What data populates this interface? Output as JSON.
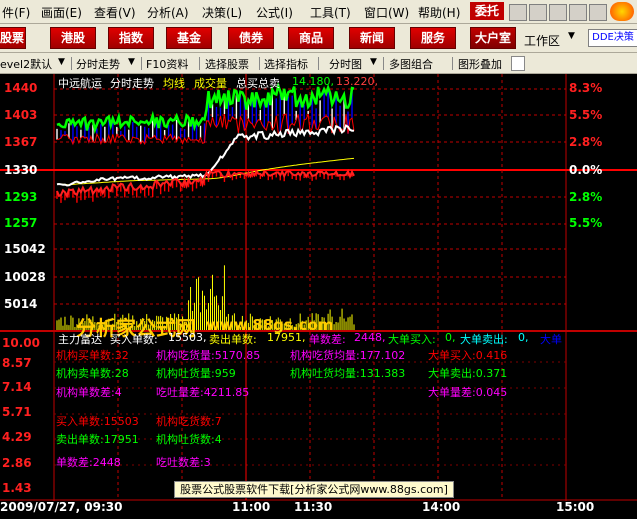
{
  "menu": {
    "items": [
      "件(F)",
      "画面(E)",
      "查看(V)",
      "分析(A)",
      "决策(L)",
      "公式(I)",
      "工具(T)",
      "窗口(W)",
      "帮助(H)"
    ],
    "weituo": "委托"
  },
  "toolbar": {
    "buttons": [
      "股票",
      "港股",
      "指数",
      "基金",
      "债券",
      "商品",
      "新闻",
      "服务",
      "大户室"
    ],
    "workspace": "工作区",
    "dde": "DDE决策"
  },
  "tabs": {
    "level": "evel2默认",
    "items": [
      "分时走势",
      "F10资料",
      "选择股票",
      "选择指标",
      "分时图",
      "多图组合",
      "图形叠加"
    ]
  },
  "header": {
    "stock": "中远航运",
    "mode": "分时走势",
    "avg": "均线",
    "vol": "成交量",
    "total": "总买总卖",
    "v1": "14.180,",
    "v2": "13.220,"
  },
  "axis": {
    "price": [
      "1440",
      "1403",
      "1367",
      "1330",
      "1293",
      "1257"
    ],
    "volume": [
      "15042",
      "10028",
      "5014"
    ],
    "pct": [
      "8.3%",
      "5.5%",
      "2.8%",
      "0.0%",
      "2.8%",
      "5.5%"
    ],
    "lower": [
      "10.00",
      "8.57",
      "7.14",
      "5.71",
      "4.29",
      "2.86",
      "1.43"
    ],
    "time": [
      "2009/07/27, 09:30",
      "11:00",
      "11:30",
      "14:00",
      "15:00"
    ]
  },
  "indicator": {
    "title": "主力富达",
    "buy_label": "买入单数:",
    "buy_val": "15503,",
    "sell_label": "卖出单数:",
    "sell_val": "17951,",
    "diff_label": "单数差:",
    "diff_val": "2448,",
    "big_buy_label": "大单买入:",
    "big_buy_val": "0,",
    "big_sell_label": "大单卖出:",
    "big_sell_val": "0,",
    "big_trunc": "大单"
  },
  "stats": {
    "r1": [
      "机构买单数:32",
      "机构吃货量:5170.85",
      "机构吃货均量:177.102",
      "大单买入:0.416"
    ],
    "r2": [
      "机构卖单数:28",
      "机构吐货量:959",
      "机构吐货均量:131.383",
      "大单卖出:0.371"
    ],
    "r3": [
      "机构单数差:4",
      "吃吐量差:4211.85",
      "大单量差:0.045"
    ],
    "r4": [
      "买入单数:15503",
      "机构吃货数:7"
    ],
    "r5": [
      "卖出单数:17951",
      "机构吐货数:4"
    ],
    "r6": [
      "单数差:2448",
      "吃吐数差:3"
    ]
  },
  "watermark": {
    "cn": "分析家公式网",
    "url": "www.88gs.com"
  },
  "banner": "股票公式股票软件下载[分析家公式网www.88gs.com]",
  "colors": {
    "red": "#ff0000",
    "green": "#00ff00",
    "yellow": "#ffff00",
    "blue": "#0000ff",
    "magenta": "#ff00ff"
  }
}
